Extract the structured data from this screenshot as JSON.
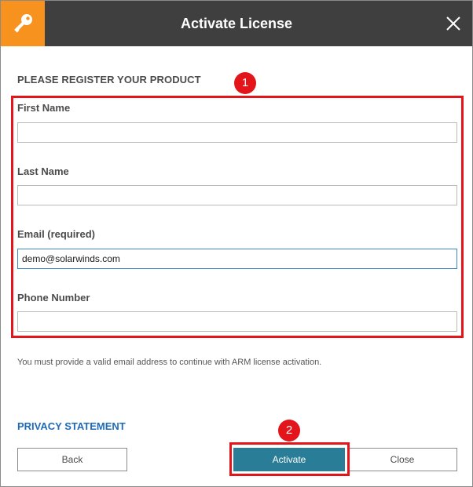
{
  "window": {
    "title": "Activate License",
    "icon": "key-icon",
    "accent_color": "#f7921e",
    "titlebar_color": "#3f3f3f"
  },
  "form": {
    "section_title": "PLEASE REGISTER YOUR PRODUCT",
    "fields": [
      {
        "label": "First Name",
        "value": ""
      },
      {
        "label": "Last Name",
        "value": ""
      },
      {
        "label": "Email (required)",
        "value": "demo@solarwinds.com"
      },
      {
        "label": "Phone Number",
        "value": ""
      }
    ],
    "help_text": "You must provide a valid email address to continue with ARM license activation."
  },
  "links": {
    "privacy": "PRIVACY STATEMENT"
  },
  "buttons": {
    "back": "Back",
    "activate": "Activate",
    "close": "Close"
  },
  "annotations": {
    "badge_1": "1",
    "badge_2": "2",
    "color": "#e3151a"
  }
}
